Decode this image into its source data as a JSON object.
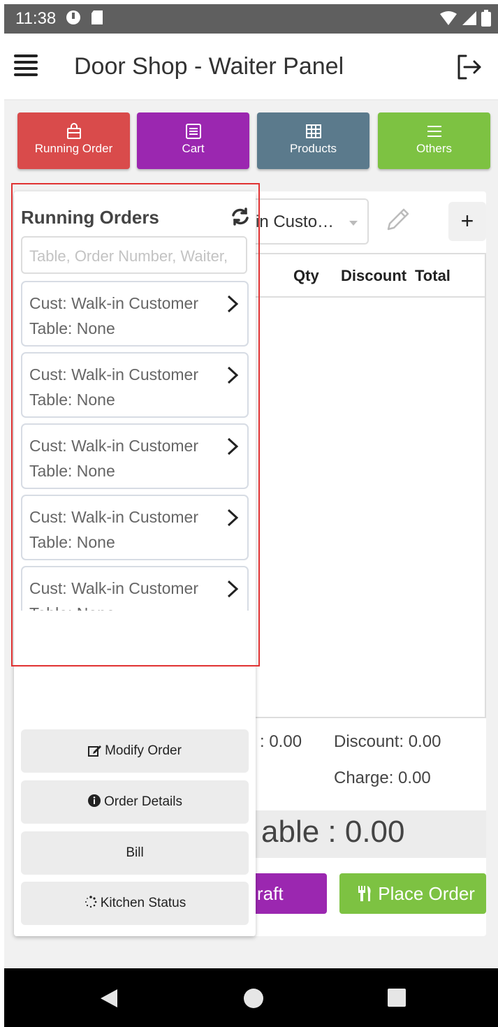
{
  "status_bar": {
    "time": "11:38"
  },
  "app_bar": {
    "title": "Door Shop - Waiter Panel",
    "menu_icon": "hamburger-menu-icon",
    "logout_icon": "logout-icon"
  },
  "top_nav": [
    {
      "label": "Running Order",
      "icon": "shopping-bag-icon",
      "color": "#d94b4b"
    },
    {
      "label": "Cart",
      "icon": "list-icon",
      "color": "#9b27b0"
    },
    {
      "label": "Products",
      "icon": "grid-icon",
      "color": "#5b7a8c"
    },
    {
      "label": "Others",
      "icon": "menu-lines-icon",
      "color": "#7dc242"
    }
  ],
  "main": {
    "customer_select": "in Custo…",
    "cart_columns": [
      "Qty",
      "Discount",
      "Total"
    ],
    "subtotal_partial": ": 0.00",
    "discount": "Discount: 0.00",
    "charge": "Charge: 0.00",
    "payable": "able : 0.00",
    "draft_button": "raft",
    "place_order_button": "Place Order",
    "add_button": "+"
  },
  "running_orders": {
    "title": "Running Orders",
    "search_placeholder": "Table, Order Number, Waiter,",
    "items": [
      {
        "customer": "Cust: Walk-in Customer",
        "table": "Table: None"
      },
      {
        "customer": "Cust: Walk-in Customer",
        "table": "Table: None"
      },
      {
        "customer": "Cust: Walk-in Customer",
        "table": "Table: None"
      },
      {
        "customer": "Cust: Walk-in Customer",
        "table": "Table: None"
      },
      {
        "customer": "Cust: Walk-in Customer",
        "table": "Table: None"
      }
    ],
    "actions": {
      "modify": "Modify Order",
      "details": "Order Details",
      "bill": "Bill",
      "kitchen": "Kitchen Status"
    }
  },
  "colors": {
    "highlight": "#e03232",
    "draft": "#9b27b0",
    "place_order": "#7dc242"
  }
}
